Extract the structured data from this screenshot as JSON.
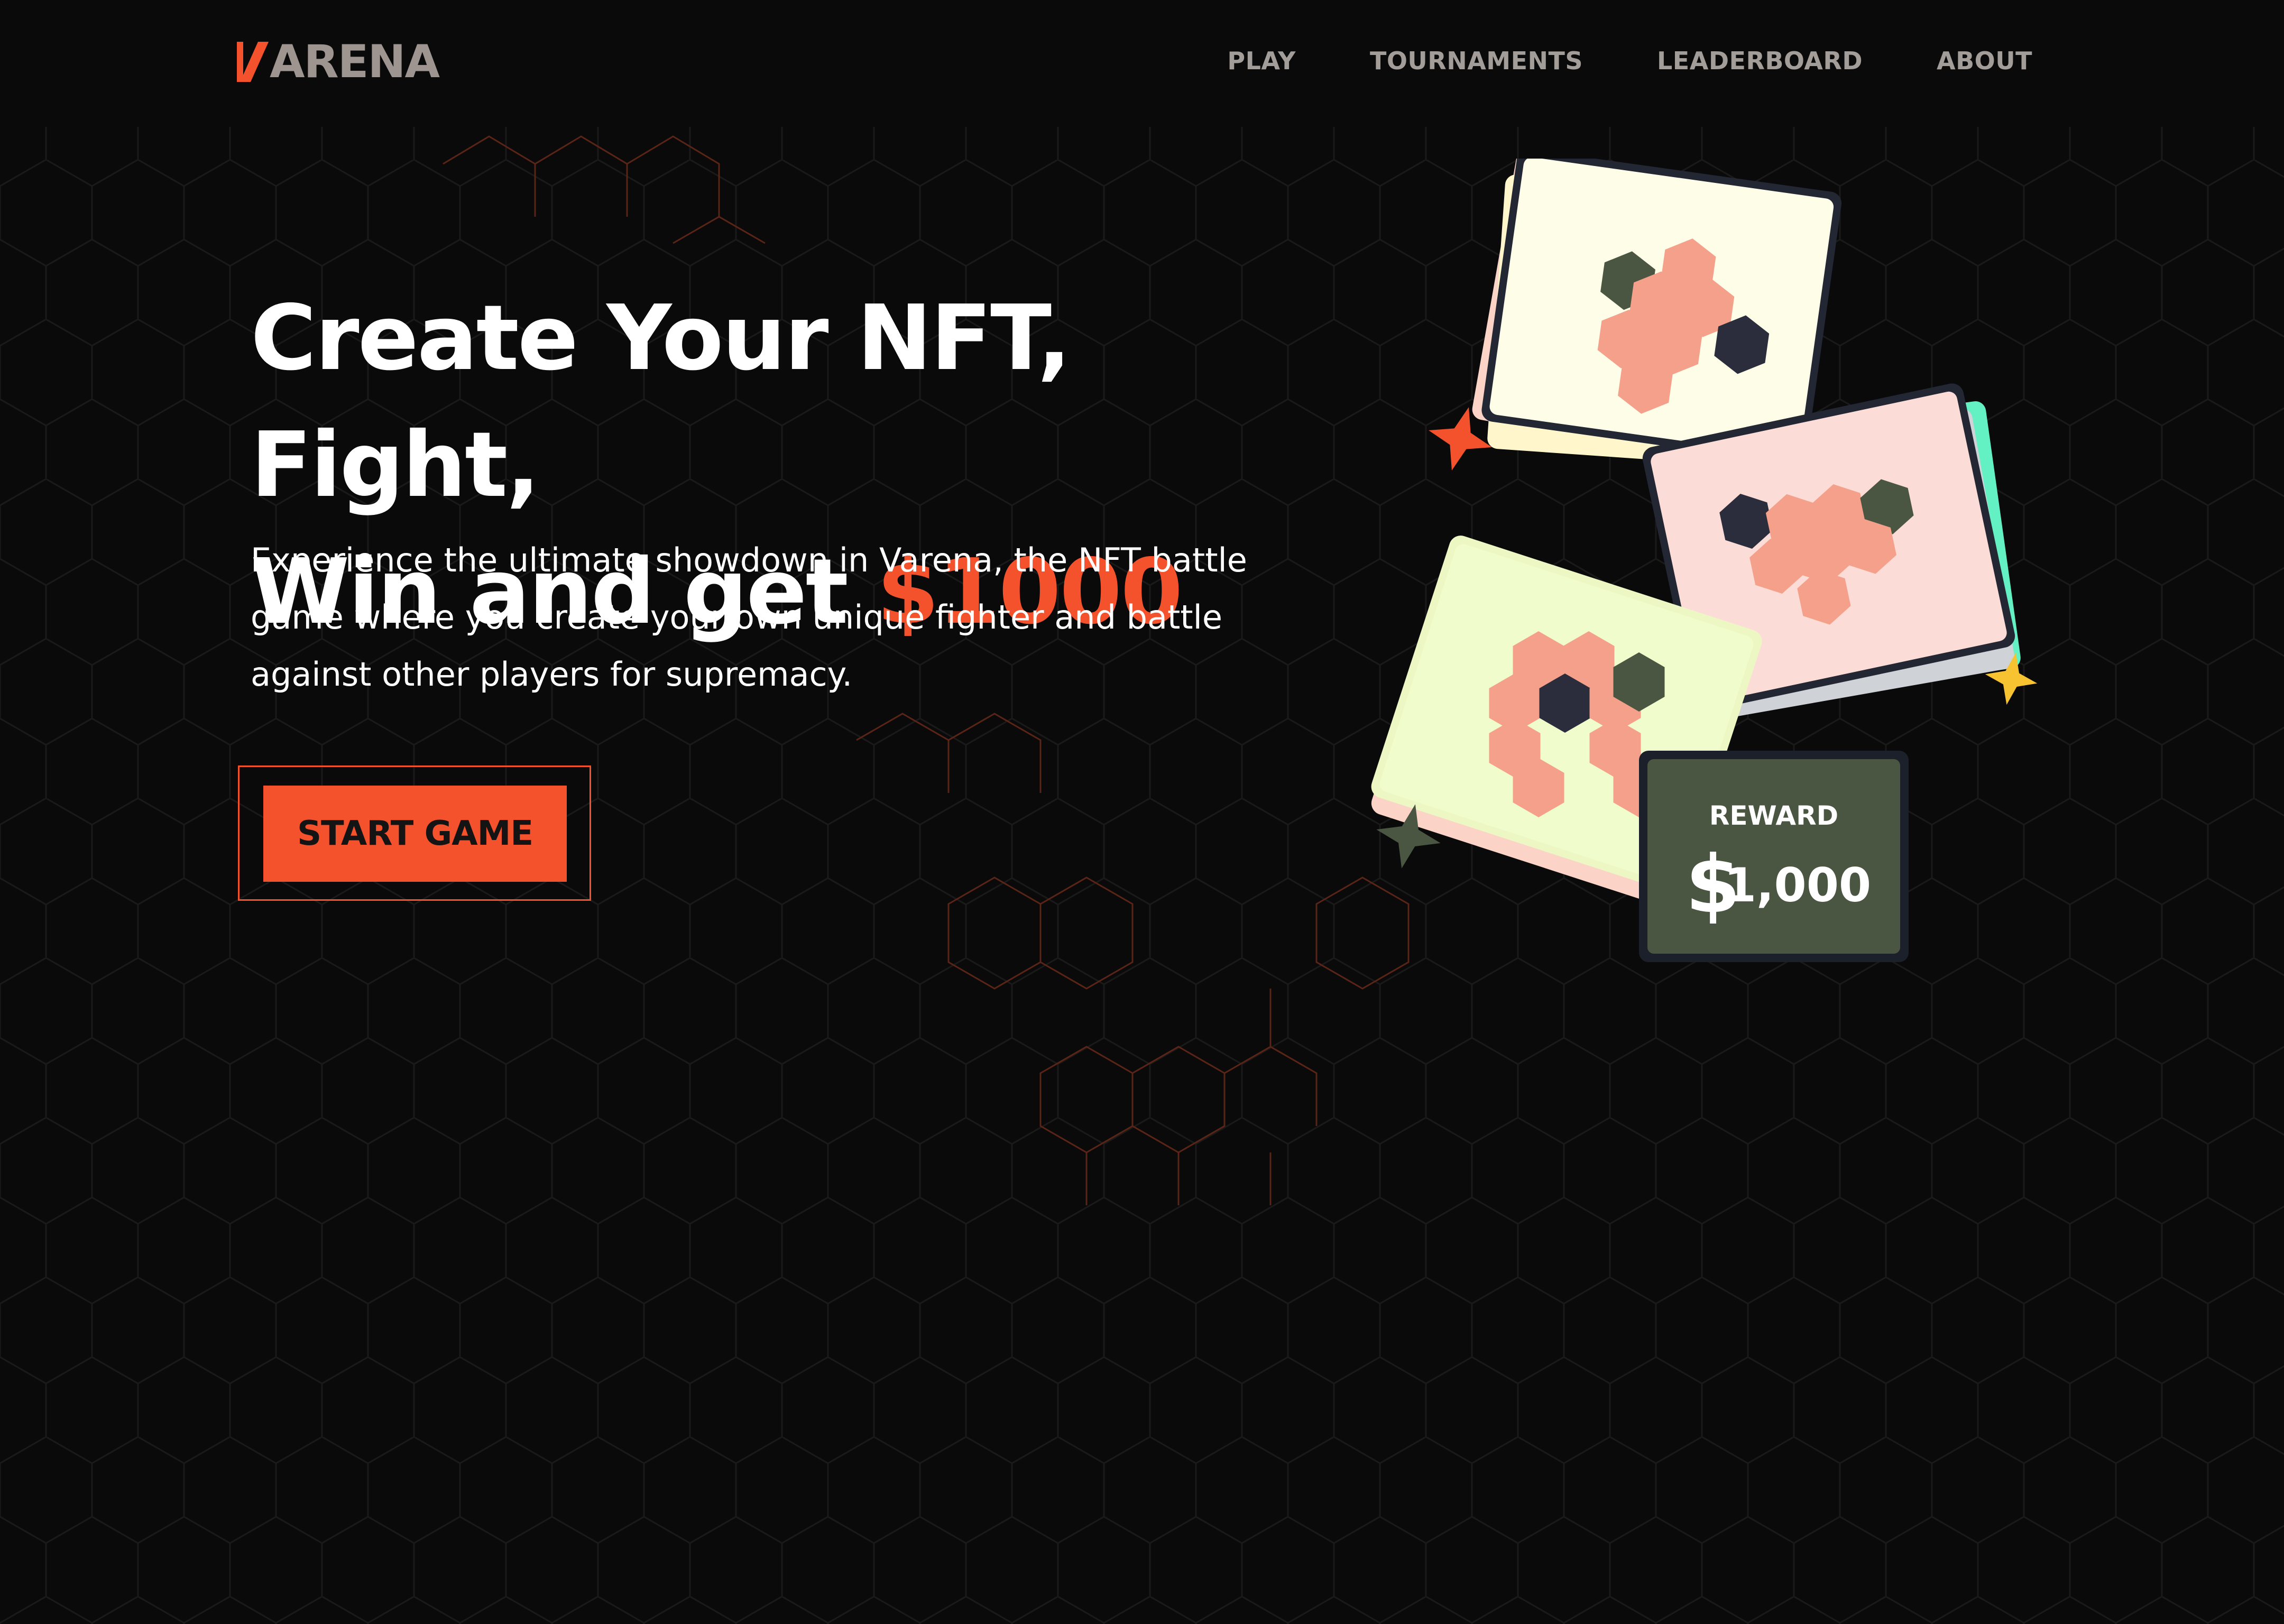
{
  "header": {
    "logo_text": "ARENA",
    "logo_mark_icon": "slash-v-logo-mark",
    "nav": [
      {
        "label": "PLAY"
      },
      {
        "label": "TOURNAMENTS"
      },
      {
        "label": "LEADERBOARD"
      },
      {
        "label": "ABOUT"
      }
    ]
  },
  "hero": {
    "headline_line1": "Create Your NFT, Fight,",
    "headline_line2_prefix": "Win and get ",
    "headline_line2_accent": "$1000",
    "description": "Experience the ultimate showdown in Varena, the NFT battle game where you create your own unique fighter and battle against other players for supremacy.",
    "cta_label": "START GAME"
  },
  "reward_card": {
    "label": "REWARD",
    "currency": "$",
    "amount": "1,000"
  },
  "colors": {
    "background": "#0a0a0a",
    "accent": "#f4512d",
    "nav_text": "#a39d99",
    "reward_bg": "#4a5641",
    "hex_salmon": "#f5a08a",
    "hex_dark": "#2b2d3c",
    "hex_olive": "#4a5641",
    "star_orange": "#f4512d",
    "star_yellow": "#f7c331",
    "star_olive": "#4a5641"
  }
}
